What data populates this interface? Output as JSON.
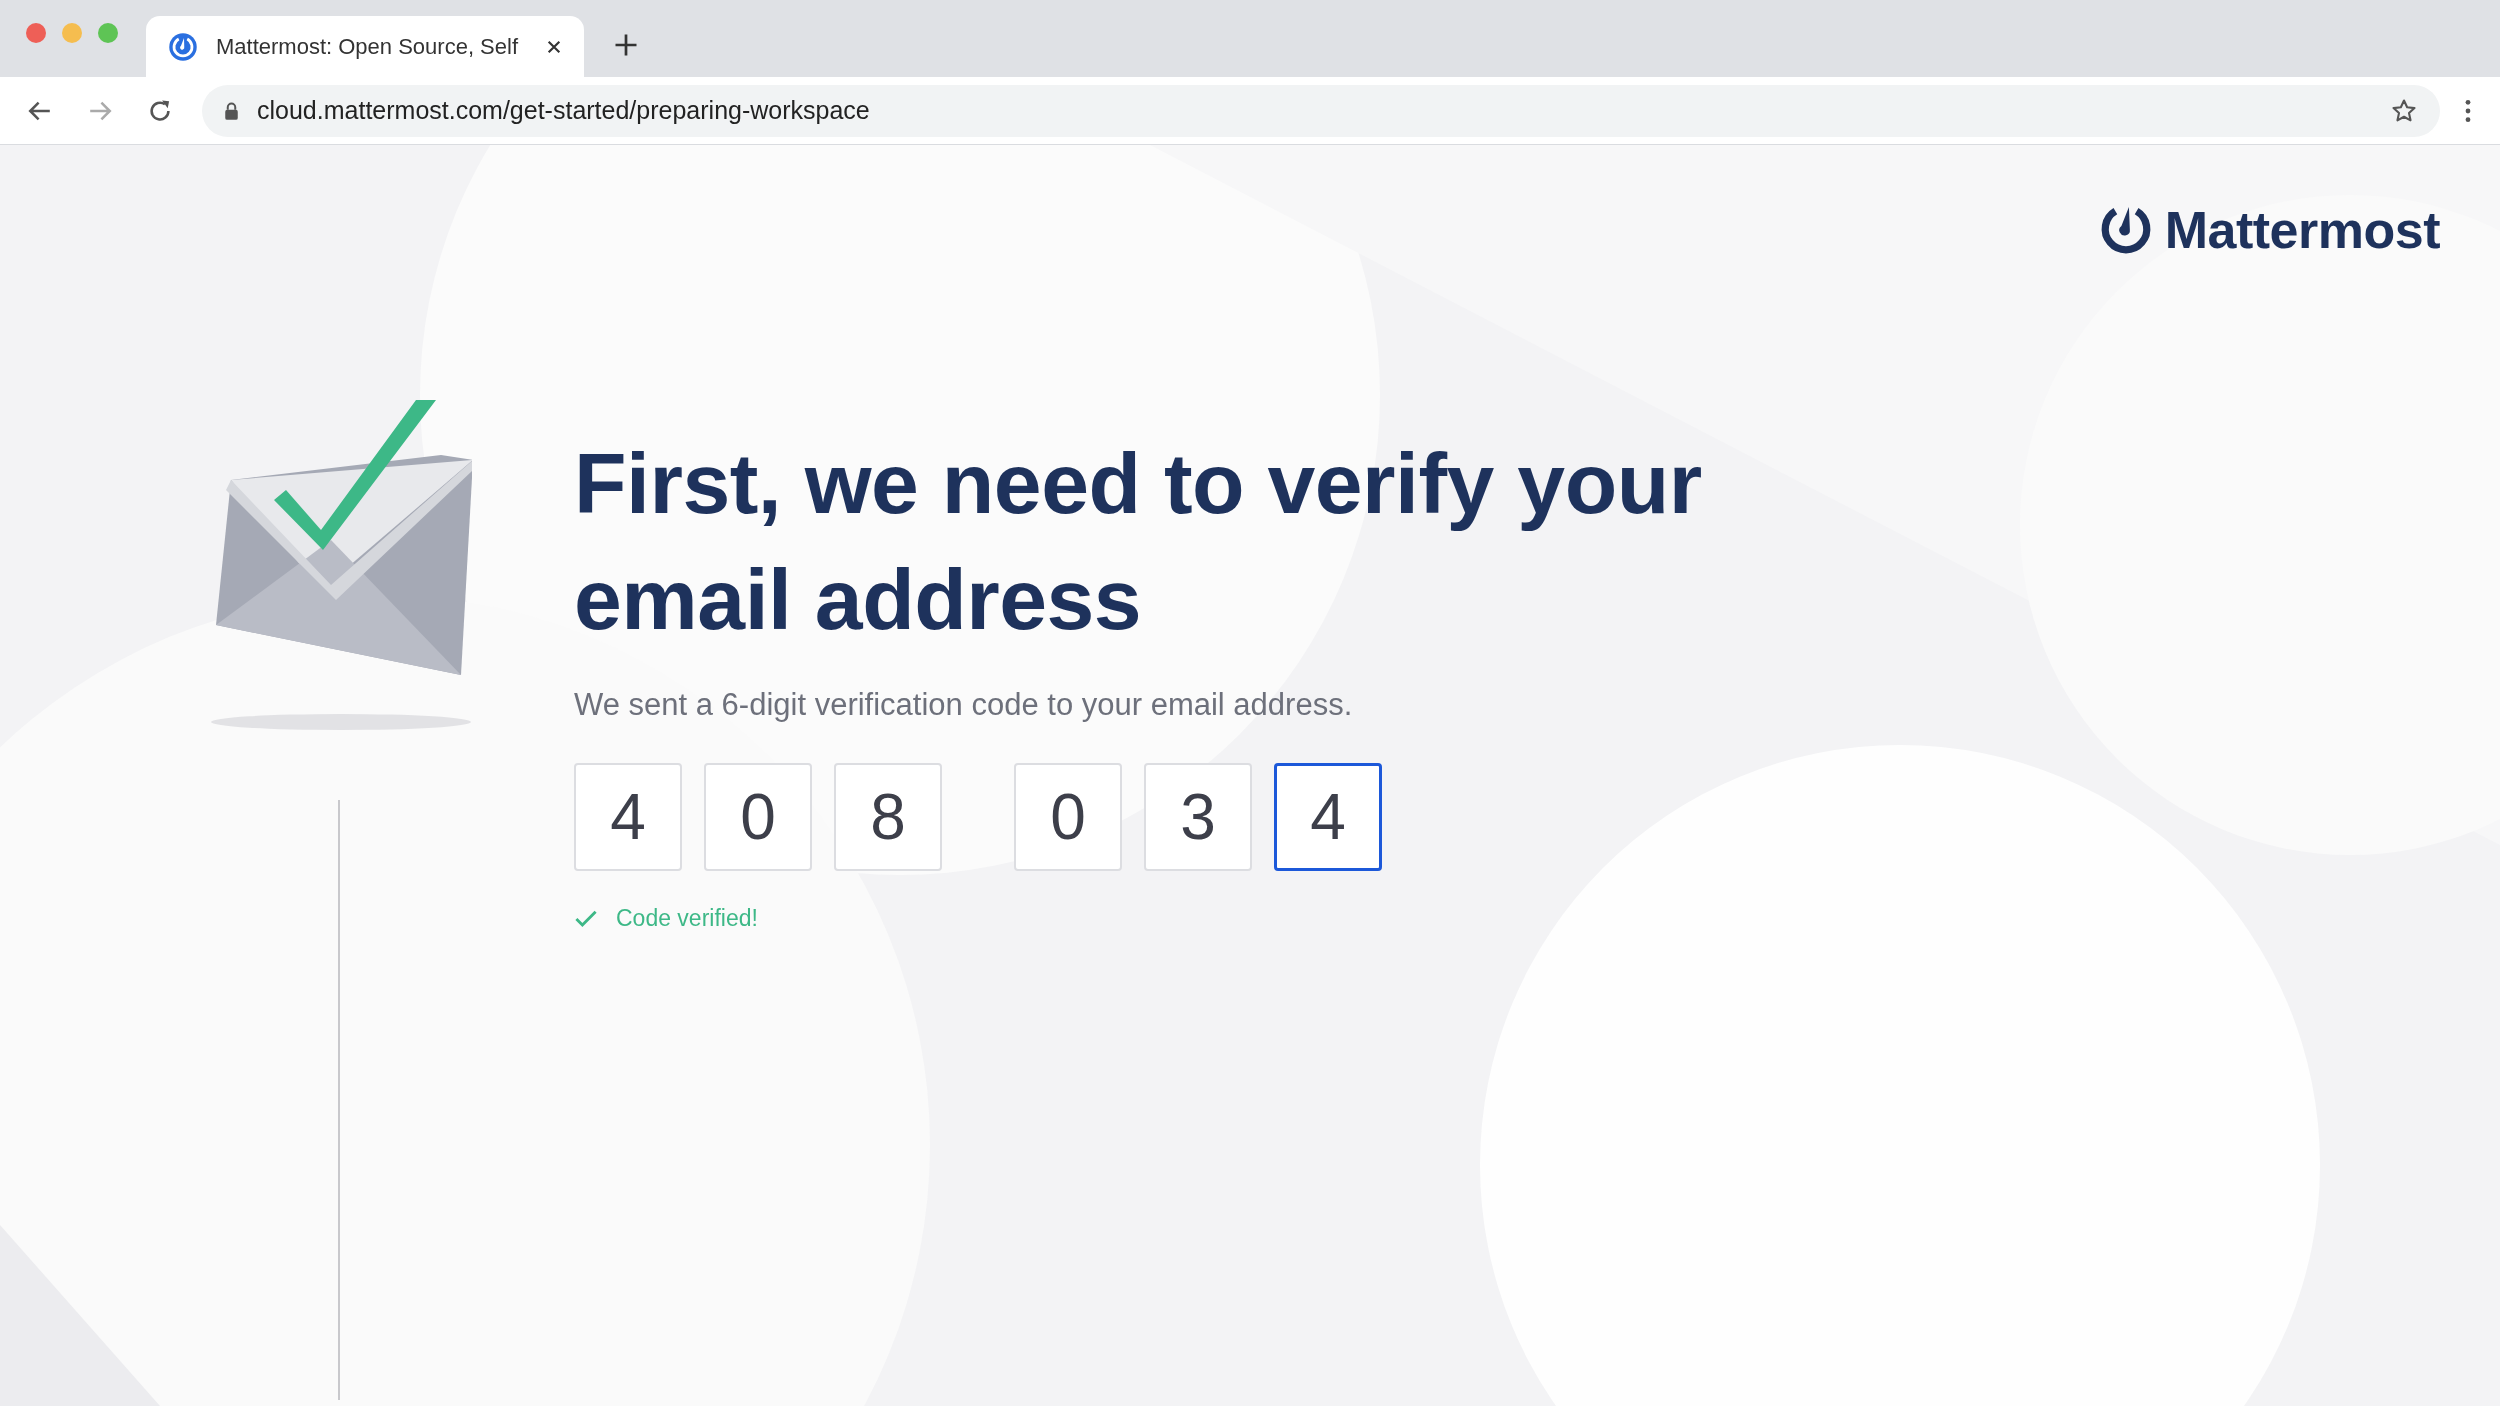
{
  "browser": {
    "tab": {
      "title": "Mattermost: Open Source, Self",
      "selected": true
    },
    "url": "cloud.mattermost.com/get-started/preparing-workspace"
  },
  "logo": {
    "text": "Mattermost"
  },
  "heading": "First, we need to verify your email address",
  "subtitle": "We sent a 6-digit verification code to your email address.",
  "code_groups": [
    [
      {
        "digit": "4",
        "focused": false
      },
      {
        "digit": "0",
        "focused": false
      },
      {
        "digit": "8",
        "focused": false
      }
    ],
    [
      {
        "digit": "0",
        "focused": false
      },
      {
        "digit": "3",
        "focused": false
      },
      {
        "digit": "4",
        "focused": true
      }
    ]
  ],
  "status": {
    "kind": "success",
    "text": "Code verified!"
  }
}
